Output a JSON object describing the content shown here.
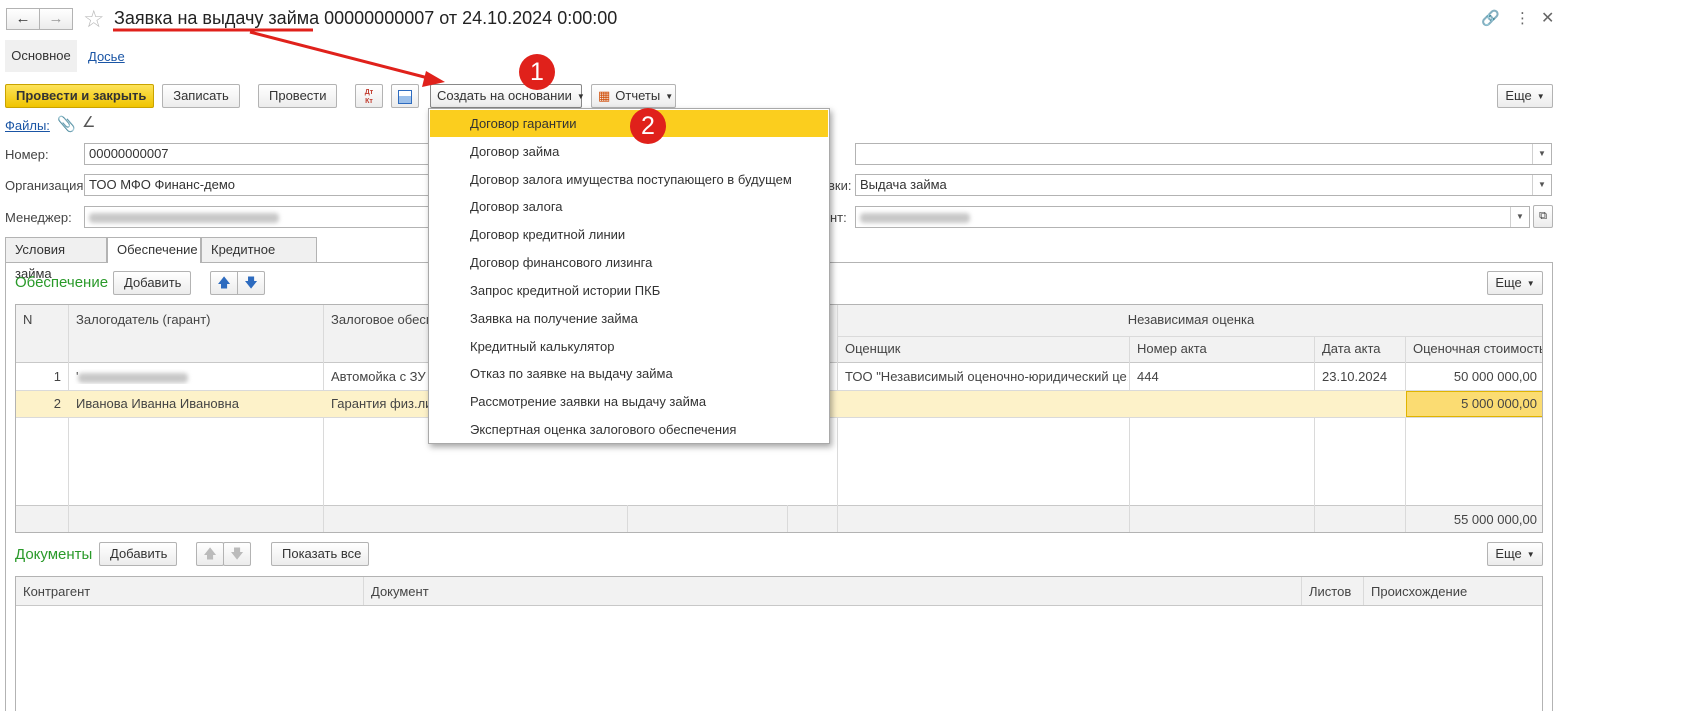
{
  "window": {
    "title": "Заявка на выдачу займа 00000000007 от 24.10.2024 0:00:00"
  },
  "nav_tabs": [
    {
      "label": "Основное"
    },
    {
      "label": "Досье"
    }
  ],
  "toolbar": {
    "post_close_label": "Провести и закрыть",
    "save_label": "Записать",
    "post_label": "Провести",
    "dtkt_label": "Дт Кт",
    "create_based_label": "Создать на основании",
    "reports_label": "Отчеты",
    "more_label": "Еще"
  },
  "files_label": "Файлы:",
  "form": {
    "number_label": "Номер:",
    "number_value": "00000000007",
    "org_label": "Организация:",
    "org_value": "ТОО МФО Финанс-демо",
    "manager_label": "Менеджер:",
    "type_label_tail": "вки:",
    "type_value": "Выдача займа",
    "client_label_tail": "нт:"
  },
  "doc_tabs": [
    {
      "label": "Условия займа"
    },
    {
      "label": "Обеспечение"
    },
    {
      "label": "Кредитное досье"
    }
  ],
  "security": {
    "title": "Обеспечение",
    "add_label": "Добавить",
    "more_label": "Еще",
    "columns": {
      "n": "N",
      "pledger": "Залогодатель (гарант)",
      "collateral": "Залоговое обесп",
      "independent": "Независимая оценка",
      "appraiser": "Оценщик",
      "act_number": "Номер акта",
      "act_date": "Дата акта",
      "value": "Оценочная стоимость"
    },
    "rows": [
      {
        "n": "1",
        "pledger": "",
        "collateral": "Автомойка с ЗУ",
        "appraiser": "ТОО \"Независимый оценочно-юридический це...",
        "act_number": "444",
        "act_date": "23.10.2024",
        "value": "50 000 000,00"
      },
      {
        "n": "2",
        "pledger": "Иванова Иванна Ивановна",
        "collateral": "Гарантия физ.лиц",
        "appraiser": "",
        "act_number": "",
        "act_date": "",
        "value": "5 000 000,00"
      }
    ],
    "total": "55 000 000,00"
  },
  "documents": {
    "title": "Документы",
    "add_label": "Добавить",
    "show_all_label": "Показать все",
    "more_label": "Еще",
    "columns": {
      "counterparty": "Контрагент",
      "document": "Документ",
      "sheets": "Листов",
      "origin": "Происхождение"
    }
  },
  "dropdown_menu": [
    {
      "label": "Договор гарантии"
    },
    {
      "label": "Договор займа"
    },
    {
      "label": "Договор залога имущества поступающего в будущем"
    },
    {
      "label": "Договор залога"
    },
    {
      "label": "Договор кредитной линии"
    },
    {
      "label": "Договор финансового лизинга"
    },
    {
      "label": "Запрос кредитной истории ПКБ"
    },
    {
      "label": "Заявка на получение займа"
    },
    {
      "label": "Кредитный калькулятор"
    },
    {
      "label": "Отказ по заявке на выдачу займа"
    },
    {
      "label": "Рассмотрение заявки на выдачу займа"
    },
    {
      "label": "Экспертная оценка залогового обеспечения"
    }
  ],
  "annotations": {
    "badge1": "1",
    "badge2": "2"
  },
  "colors": {
    "accent_yellow": "#fbce1e",
    "primary_button": "#f0c400",
    "annotation_red": "#e0211b",
    "section_green": "#2a9a2a",
    "selected_row": "#fdf2c9"
  }
}
